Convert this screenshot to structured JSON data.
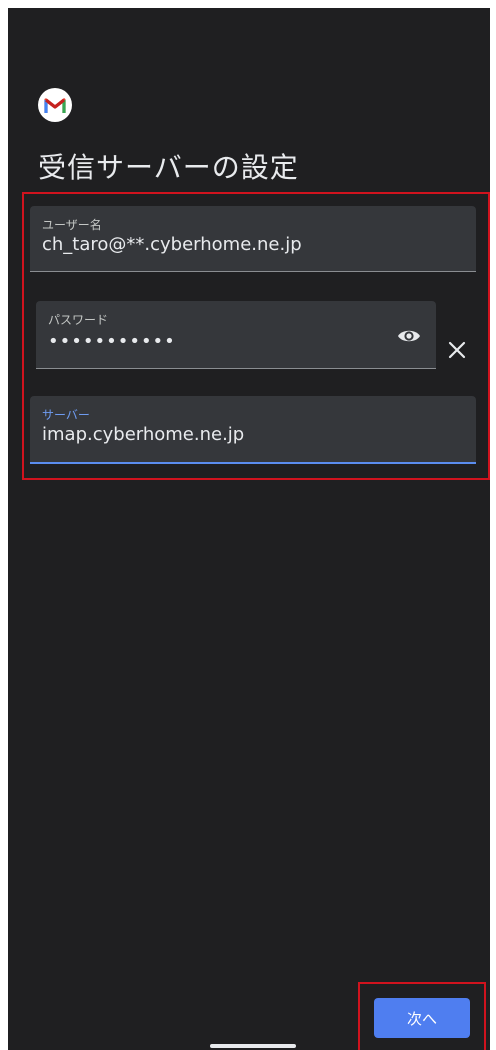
{
  "app": {
    "title": "受信サーバーの設定",
    "logo_icon": "gmail-icon"
  },
  "fields": {
    "username": {
      "label": "ユーザー名",
      "value": "ch_taro@**.cyberhome.ne.jp"
    },
    "password": {
      "label": "パスワード",
      "value": "•••••••••••"
    },
    "server": {
      "label": "サーバー",
      "value": "imap.cyberhome.ne.jp"
    }
  },
  "buttons": {
    "next_label": "次へ"
  },
  "colors": {
    "background": "#1f1f21",
    "field_bg": "#35373b",
    "accent": "#4f7ef0",
    "highlight": "#d0131e"
  }
}
